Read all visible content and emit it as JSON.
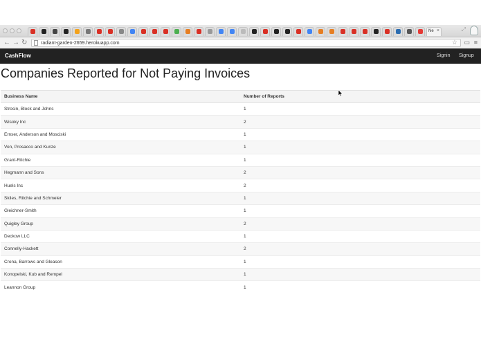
{
  "browser": {
    "url": "radiant-garden-2659.herokuapp.com",
    "active_tab_label": "Ne",
    "tab_favicon_colors": [
      "#d93025",
      "#222222",
      "#444444",
      "#222222",
      "#f3a21b",
      "#777777",
      "#d93025",
      "#d93025",
      "#888888",
      "#4285f4",
      "#d93025",
      "#d93025",
      "#d93025",
      "#4caf50",
      "#e67e22",
      "#d93025",
      "#999999",
      "#4285f4",
      "#4285f4",
      "#bbbbbb",
      "#222222",
      "#d93025",
      "#222222",
      "#222222",
      "#d93025",
      "#4285f4",
      "#e67e22",
      "#e67e22",
      "#d93025",
      "#d93025",
      "#d93025",
      "#222222",
      "#d93025",
      "#2b6cb0",
      "#555555",
      "#e53935"
    ]
  },
  "app": {
    "brand": "CashFlow",
    "nav": {
      "signin": "Signin",
      "signup": "Signup"
    },
    "title": "Companies Reported for Not Paying Invoices",
    "table": {
      "headers": {
        "name": "Business Name",
        "reports": "Number of Reports"
      },
      "rows": [
        {
          "name": "Strosin, Block and Johns",
          "reports": "1"
        },
        {
          "name": "Wisoky Inc",
          "reports": "2"
        },
        {
          "name": "Ernser, Anderson and Mosciski",
          "reports": "1"
        },
        {
          "name": "Von, Prosacco and Kunze",
          "reports": "1"
        },
        {
          "name": "Grant-Ritchie",
          "reports": "1"
        },
        {
          "name": "Hegmann and Sons",
          "reports": "2"
        },
        {
          "name": "Huels Inc",
          "reports": "2"
        },
        {
          "name": "Skiles, Ritchie and Schmeler",
          "reports": "1"
        },
        {
          "name": "Gleichner-Smith",
          "reports": "1"
        },
        {
          "name": "Quigley Group",
          "reports": "2"
        },
        {
          "name": "Deckow LLC",
          "reports": "1"
        },
        {
          "name": "Connelly-Hackett",
          "reports": "2"
        },
        {
          "name": "Crona, Barrows and Gleason",
          "reports": "1"
        },
        {
          "name": "Konopelski, Kub and Rempel",
          "reports": "1"
        },
        {
          "name": "Leannon Group",
          "reports": "1"
        }
      ]
    }
  }
}
